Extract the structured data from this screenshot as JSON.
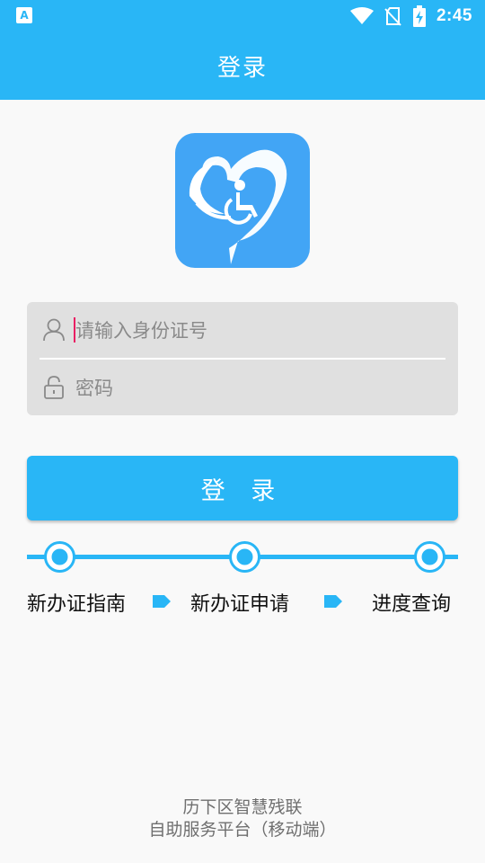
{
  "status_bar": {
    "left_icon": "A",
    "time": "2:45",
    "icons": [
      "wifi-icon",
      "no-sim-icon",
      "battery-charging-icon"
    ]
  },
  "app_bar": {
    "title": "登录"
  },
  "logo": {
    "icon": "heart-wheelchair-logo"
  },
  "login_form": {
    "id_placeholder": "请输入身份证号",
    "password_placeholder": "密码",
    "user_icon": "user-icon",
    "lock_icon": "lock-icon"
  },
  "login_button": {
    "label": "登 录"
  },
  "steps": [
    {
      "label": "新办证指南"
    },
    {
      "label": "新办证申请"
    },
    {
      "label": "进度查询"
    }
  ],
  "footer": {
    "line1": "历下区智慧残联",
    "line2": "自助服务平台（移动端）"
  },
  "colors": {
    "accent": "#29b6f6",
    "logo_bg": "#42a5f5",
    "cursor": "#e91e63"
  }
}
